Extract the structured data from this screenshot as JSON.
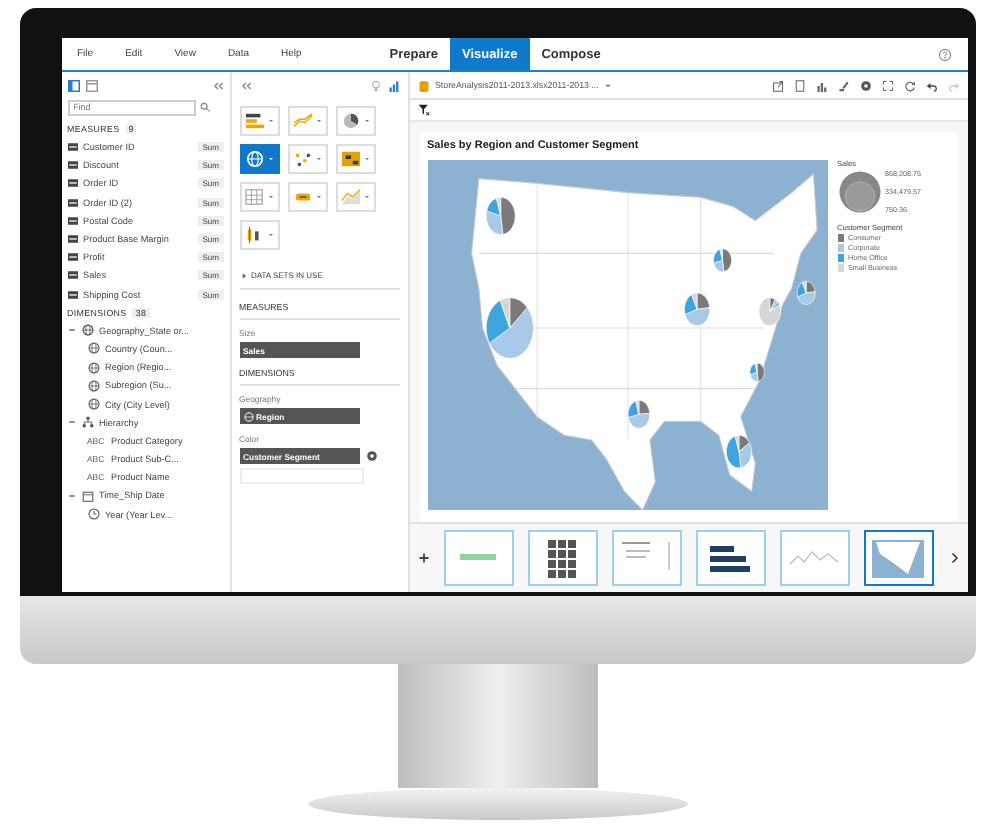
{
  "menu": [
    "File",
    "Edit",
    "View",
    "Data",
    "Help"
  ],
  "modes": [
    {
      "label": "Prepare",
      "selected": false
    },
    {
      "label": "Visualize",
      "selected": true
    },
    {
      "label": "Compose",
      "selected": false
    }
  ],
  "left_panel": {
    "search": {
      "placeholder": "Find"
    },
    "measures": {
      "title": "MEASURES",
      "count": "9",
      "items": [
        {
          "name": "Customer ID",
          "agg": "Sum"
        },
        {
          "name": "Discount",
          "agg": "Sum"
        },
        {
          "name": "Order ID",
          "agg": "Sum"
        },
        {
          "name": "Order ID (2)",
          "agg": "Sum"
        },
        {
          "name": "Postal Code",
          "agg": "Sum"
        },
        {
          "name": "Product Base Margin",
          "agg": "Sum"
        },
        {
          "name": "Profit",
          "agg": "Sum"
        },
        {
          "name": "Sales",
          "agg": "Sum"
        },
        {
          "name": "Shipping Cost",
          "agg": "Sum"
        }
      ]
    },
    "dimensions": {
      "title": "DIMENSIONS",
      "count": "38",
      "items": [
        {
          "name": "Geography_State or...",
          "kind": "geo",
          "expanded": true,
          "children": [
            {
              "name": "Country (Coun...",
              "kind": "geo"
            },
            {
              "name": "Region (Regio...",
              "kind": "geo"
            },
            {
              "name": "Subregion (Su...",
              "kind": "geo"
            },
            {
              "name": "City (City Level)",
              "kind": "geo"
            }
          ]
        },
        {
          "name": "Hierarchy",
          "kind": "hierarchy",
          "expanded": true,
          "children": [
            {
              "name": "Product Category",
              "kind": "text",
              "badge": "ABC"
            },
            {
              "name": "Product Sub-C...",
              "kind": "text",
              "badge": "ABC"
            },
            {
              "name": "Product Name",
              "kind": "text",
              "badge": "ABC"
            }
          ]
        },
        {
          "name": "Time_Ship Date",
          "kind": "time",
          "expanded": true,
          "children": [
            {
              "name": "Year (Year Lev...",
              "kind": "time"
            }
          ]
        }
      ]
    }
  },
  "chart_types": [
    {
      "kind": "bar",
      "selected": false
    },
    {
      "kind": "line",
      "selected": false
    },
    {
      "kind": "pie",
      "selected": false
    },
    {
      "kind": "geo",
      "selected": true
    },
    {
      "kind": "scatter",
      "selected": false
    },
    {
      "kind": "heat",
      "selected": false
    },
    {
      "kind": "table",
      "selected": false
    },
    {
      "kind": "tag",
      "selected": false
    },
    {
      "kind": "area",
      "selected": false
    },
    {
      "kind": "box",
      "selected": false
    }
  ],
  "builder": {
    "datasets": "DATA SETS IN USE",
    "sections": [
      {
        "title": "MEASURES",
        "fields": [
          {
            "label": "Size",
            "value": "Sales",
            "kind": "measure"
          }
        ]
      },
      {
        "title": "DIMENSIONS",
        "fields": [
          {
            "label": "Geography",
            "value": "Region",
            "kind": "geo"
          },
          {
            "label": "Color",
            "value": "Customer Segment",
            "kind": "color"
          }
        ]
      }
    ]
  },
  "dataset": "StoreAnalysis2011-2013.xlsx2011-2013 ...",
  "chart": {
    "title": "Sales by Region and Customer Segment",
    "size_legend": {
      "title": "Sales",
      "values": [
        "868,208.75",
        "334,479.57",
        "750.36"
      ]
    },
    "color_legend": {
      "title": "Customer Segment",
      "items": [
        {
          "label": "Consumer",
          "color": "#7a7a7a"
        },
        {
          "label": "Corporate",
          "color": "#a9c9e8"
        },
        {
          "label": "Home Office",
          "color": "#3fa3dc"
        },
        {
          "label": "Small Business",
          "color": "#d6d6d6"
        }
      ]
    }
  },
  "thumbnails": [
    {
      "kind": "number",
      "selected": false
    },
    {
      "kind": "grid",
      "selected": false
    },
    {
      "kind": "text",
      "selected": false
    },
    {
      "kind": "bars",
      "selected": false
    },
    {
      "kind": "line",
      "selected": false
    },
    {
      "kind": "map",
      "selected": true
    }
  ]
}
